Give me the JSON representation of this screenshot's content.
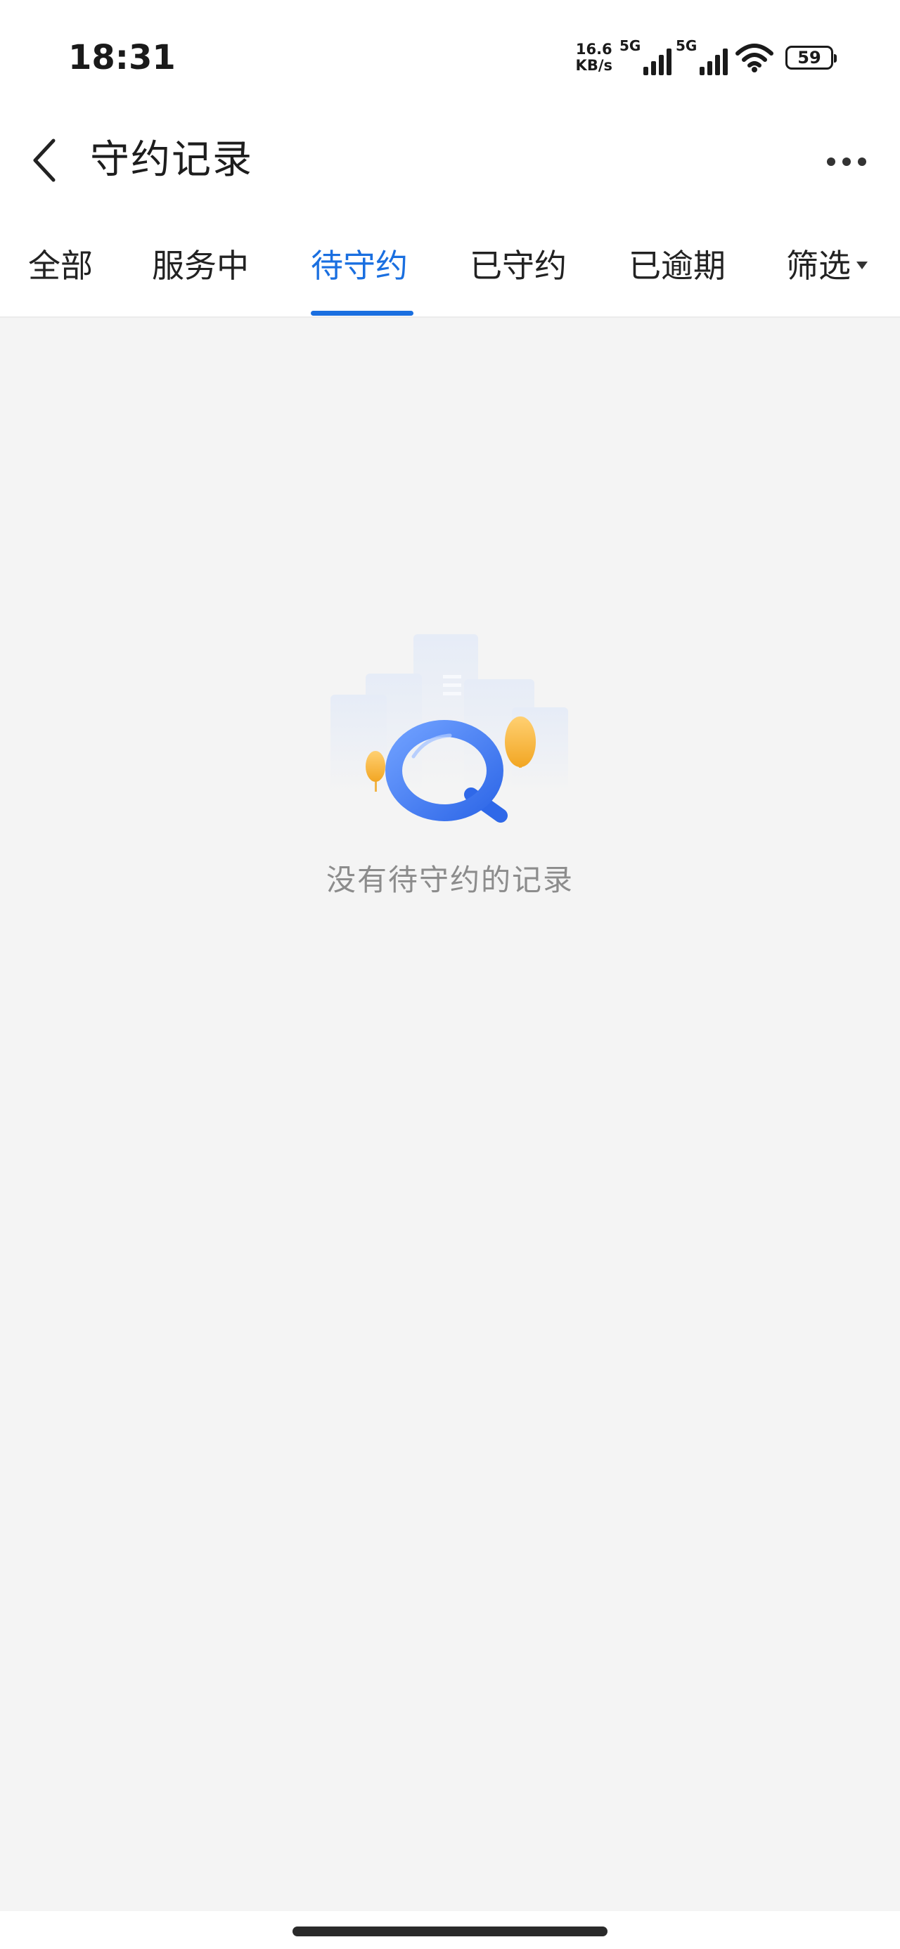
{
  "status_bar": {
    "time": "18:31",
    "net_speed_value": "16.6",
    "net_speed_unit": "KB/s",
    "sim1_tag": "5G",
    "sim2_tag": "5G",
    "battery": "59"
  },
  "header": {
    "title": "守约记录"
  },
  "tabs": [
    {
      "label": "全部",
      "active": false
    },
    {
      "label": "服务中",
      "active": false
    },
    {
      "label": "待守约",
      "active": true
    },
    {
      "label": "已守约",
      "active": false
    },
    {
      "label": "已逾期",
      "active": false
    },
    {
      "label": "筛选",
      "active": false
    }
  ],
  "empty_state": {
    "message": "没有待守约的记录"
  },
  "colors": {
    "accent": "#1a6fe0",
    "background": "#f4f4f4",
    "illustration_blue": "#3f7cf2",
    "illustration_yellow": "#f7b733"
  }
}
